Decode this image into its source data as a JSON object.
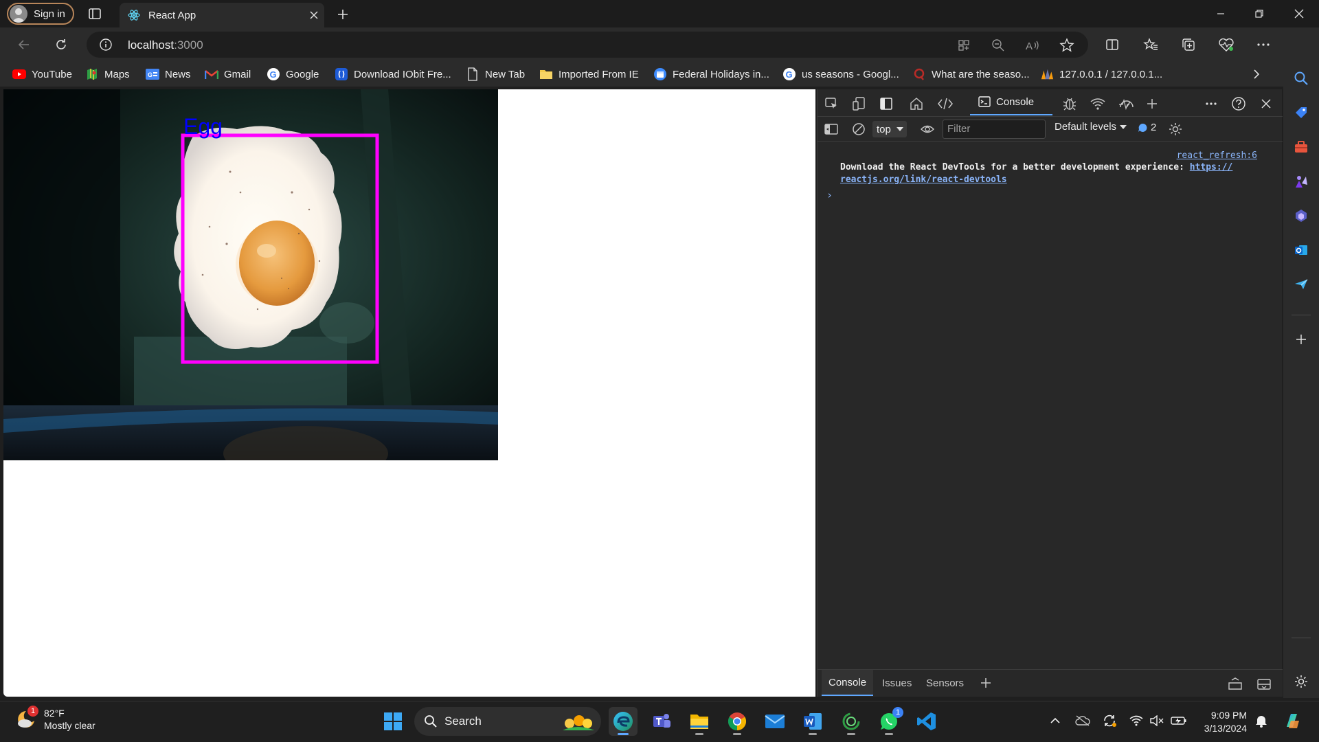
{
  "browser": {
    "profile_label": "Sign in",
    "tab_title": "React App",
    "url_host": "localhost",
    "url_port": ":3000"
  },
  "favorites": [
    {
      "label": "YouTube",
      "icon": "youtube-icon"
    },
    {
      "label": "Maps",
      "icon": "maps-icon"
    },
    {
      "label": "News",
      "icon": "news-icon"
    },
    {
      "label": "Gmail",
      "icon": "gmail-icon"
    },
    {
      "label": "Google",
      "icon": "google-icon"
    },
    {
      "label": "Download IObit Fre...",
      "icon": "iobit-icon"
    },
    {
      "label": "New Tab",
      "icon": "page-icon"
    },
    {
      "label": "Imported From IE",
      "icon": "folder-icon"
    },
    {
      "label": "Federal Holidays in...",
      "icon": "calendar-icon"
    },
    {
      "label": "us seasons - Googl...",
      "icon": "google-icon"
    },
    {
      "label": "What are the seaso...",
      "icon": "quora-icon"
    },
    {
      "label": "127.0.0.1 / 127.0.0.1...",
      "icon": "phpmyadmin-icon"
    }
  ],
  "page": {
    "detection": {
      "label": "Egg",
      "box_color": "#ff00ff",
      "label_color": "#0000ff"
    }
  },
  "devtools": {
    "active_panel": "Console",
    "context": "top",
    "filter_placeholder": "Filter",
    "levels": "Default levels",
    "issues_count": "2",
    "messages": [
      {
        "source": "react_refresh:6",
        "text": "Download the React DevTools for a better development experience: ",
        "link_part1": "https://",
        "link_part2": "reactjs.org/link/react-devtools"
      }
    ],
    "drawer_tabs": [
      "Console",
      "Issues",
      "Sensors"
    ]
  },
  "taskbar": {
    "temperature": "82°F",
    "weather": "Mostly clear",
    "weather_badge": "1",
    "search_label": "Search",
    "time": "9:09 PM",
    "date": "3/13/2024",
    "whatsapp_badge": "1"
  },
  "colors": {
    "accent": "#5fa8ff",
    "devtools_bg": "#282828",
    "link": "#8ab4f8"
  }
}
